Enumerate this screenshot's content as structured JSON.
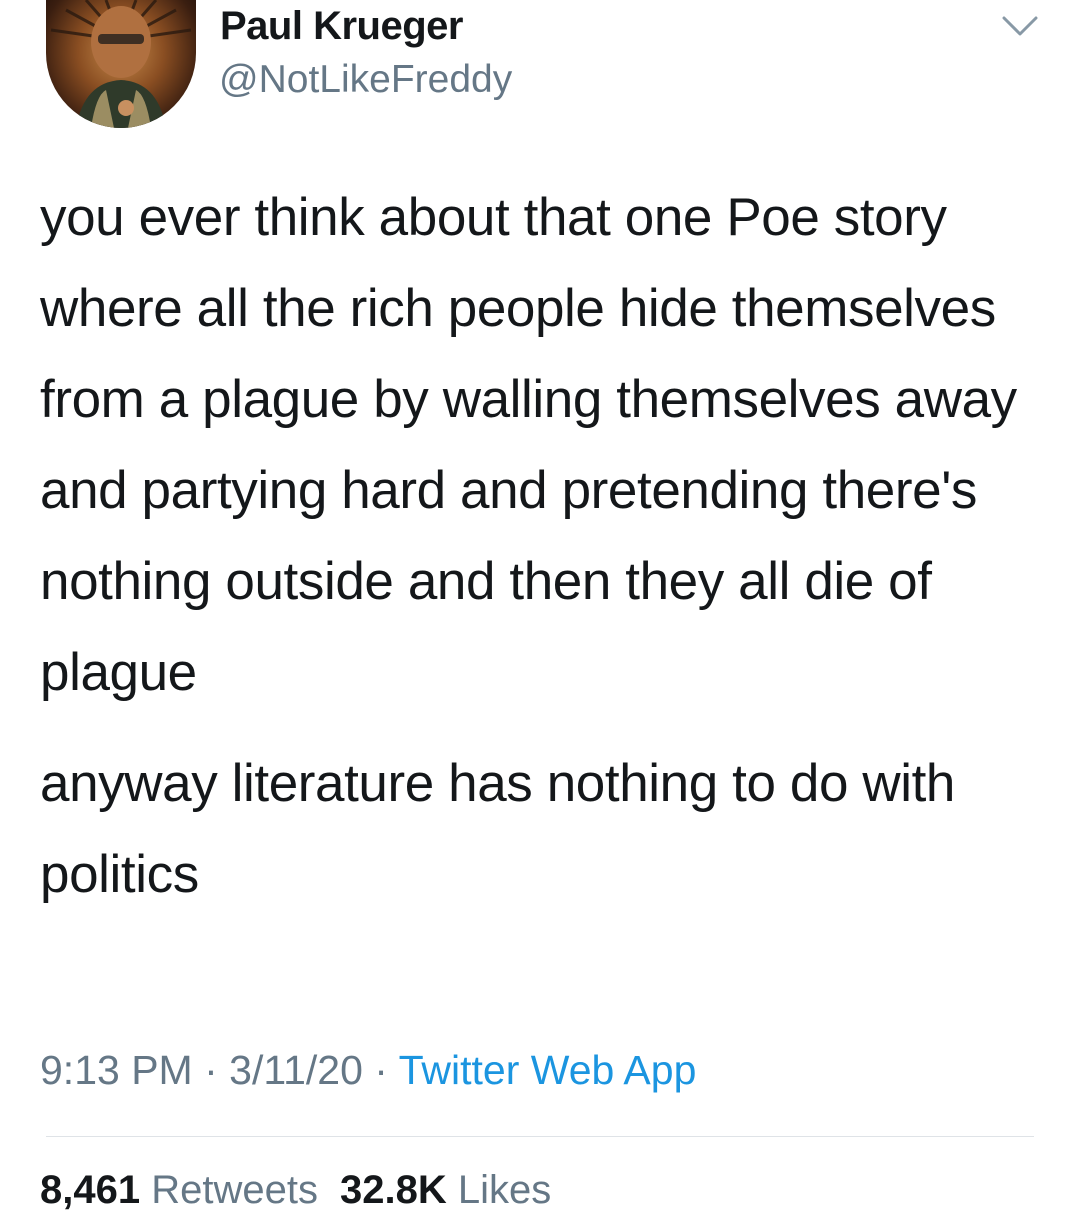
{
  "user": {
    "display_name": "Paul Krueger",
    "handle": "@NotLikeFreddy"
  },
  "tweet": {
    "paragraphs": [
      "you ever think about that one Poe story where all the rich people hide themselves from a plague by walling themselves away and partying hard and pretending there's nothing outside and then they all die of plague",
      "anyway literature has nothing to do with politics"
    ]
  },
  "meta": {
    "time": "9:13 PM",
    "separator": " · ",
    "date": "3/11/20",
    "source": "Twitter Web App"
  },
  "stats": {
    "retweets_count": "8,461",
    "retweets_label": "Retweets",
    "likes_count": "32.8K",
    "likes_label": "Likes"
  },
  "icons": {
    "avatar": "avatar-photo",
    "caret": "chevron-down-icon"
  },
  "colors": {
    "text": "#14171a",
    "secondary": "#657786",
    "link": "#1b95e0"
  }
}
